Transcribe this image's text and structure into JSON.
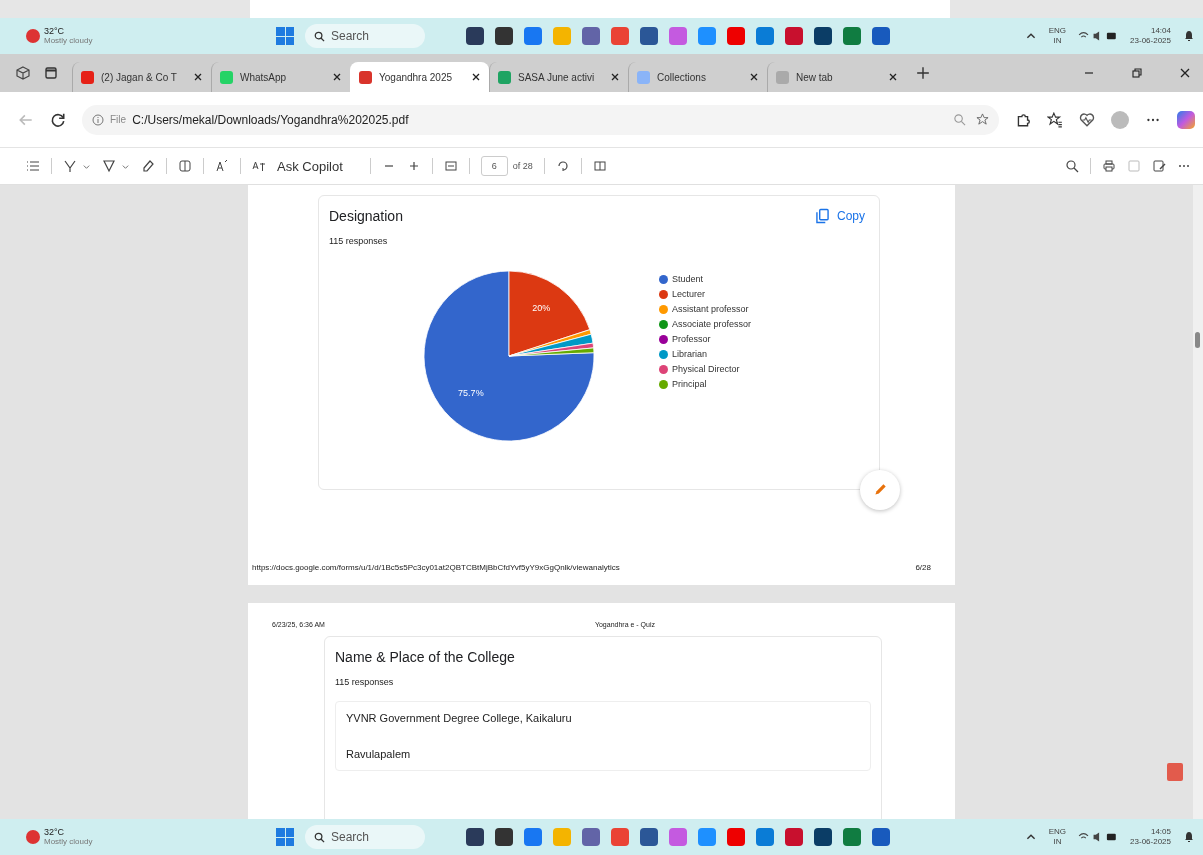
{
  "taskbar_top": {
    "weather": {
      "temperature": "32°C",
      "condition": "Mostly cloudy"
    },
    "search": {
      "placeholder": "Search"
    },
    "language": [
      "ENG",
      "IN"
    ],
    "time": "14:04",
    "date": "23-06-2025"
  },
  "tabs": [
    {
      "label": "(2) Jagan & Co T",
      "kind": "video",
      "selected": false
    },
    {
      "label": "WhatsApp",
      "kind": "chat",
      "selected": false
    },
    {
      "label": "Yogandhra 2025",
      "kind": "pdf",
      "selected": true
    },
    {
      "label": "SASA June activi",
      "kind": "sheet",
      "selected": false
    },
    {
      "label": "Collections",
      "kind": "collections",
      "selected": false
    },
    {
      "label": "New tab",
      "kind": "newtab",
      "selected": false
    }
  ],
  "address_bar": {
    "scheme": "File",
    "url": "C:/Users/mekal/Downloads/Yogandhra%202025.pdf"
  },
  "pdf_toolbar": {
    "ask_copilot": "Ask Copilot",
    "page": "6",
    "page_count": "of 28"
  },
  "page_1": {
    "card": {
      "title": "Designation",
      "copy": "Copy",
      "responses": "115 responses",
      "legend": [
        {
          "color": "#3366cc"
        },
        {
          "color": "#dc3912"
        },
        {
          "color": "#ff9900"
        },
        {
          "color": "#109618"
        },
        {
          "color": "#990099"
        },
        {
          "color": "#0099c6"
        },
        {
          "color": "#dd4477"
        },
        {
          "color": "#66aa00"
        }
      ],
      "chart_data": {
        "type": "pie",
        "categories": [
          "Student",
          "Lecturer",
          "Assistant professor",
          "Associate professor",
          "Professor",
          "Librarian",
          "Physical Director",
          "Principal"
        ],
        "values": [
          75.7,
          20,
          0.9,
          0,
          0,
          1.7,
          0.9,
          0.9
        ],
        "value_labels": [
          "75.7%",
          "20%",
          null,
          null,
          null,
          null,
          null,
          null
        ]
      }
    },
    "footer": {
      "url": "https://docs.google.com/forms/u/1/d/1Bc5s5Pc3cy01at2QBTCBtMjBbCfdYvf5yY9xGgQnlk/viewanalytics",
      "page": "6/28"
    }
  },
  "page_2": {
    "header": {
      "date": "6/23/25, 6:36 AM",
      "title": "Yogandhra e - Quiz"
    },
    "card": {
      "title": "Name & Place of the College",
      "responses": "115 responses",
      "answers": [
        "YVNR Government Degree College, Kaikaluru",
        "Ravulapalem"
      ]
    }
  },
  "taskbar_bottom": {
    "weather": {
      "temperature": "32°C",
      "condition": "Mostly cloudy"
    },
    "search": {
      "placeholder": "Search"
    },
    "language": [
      "ENG",
      "IN"
    ],
    "time": "14:05",
    "date": "23-06-2025"
  }
}
